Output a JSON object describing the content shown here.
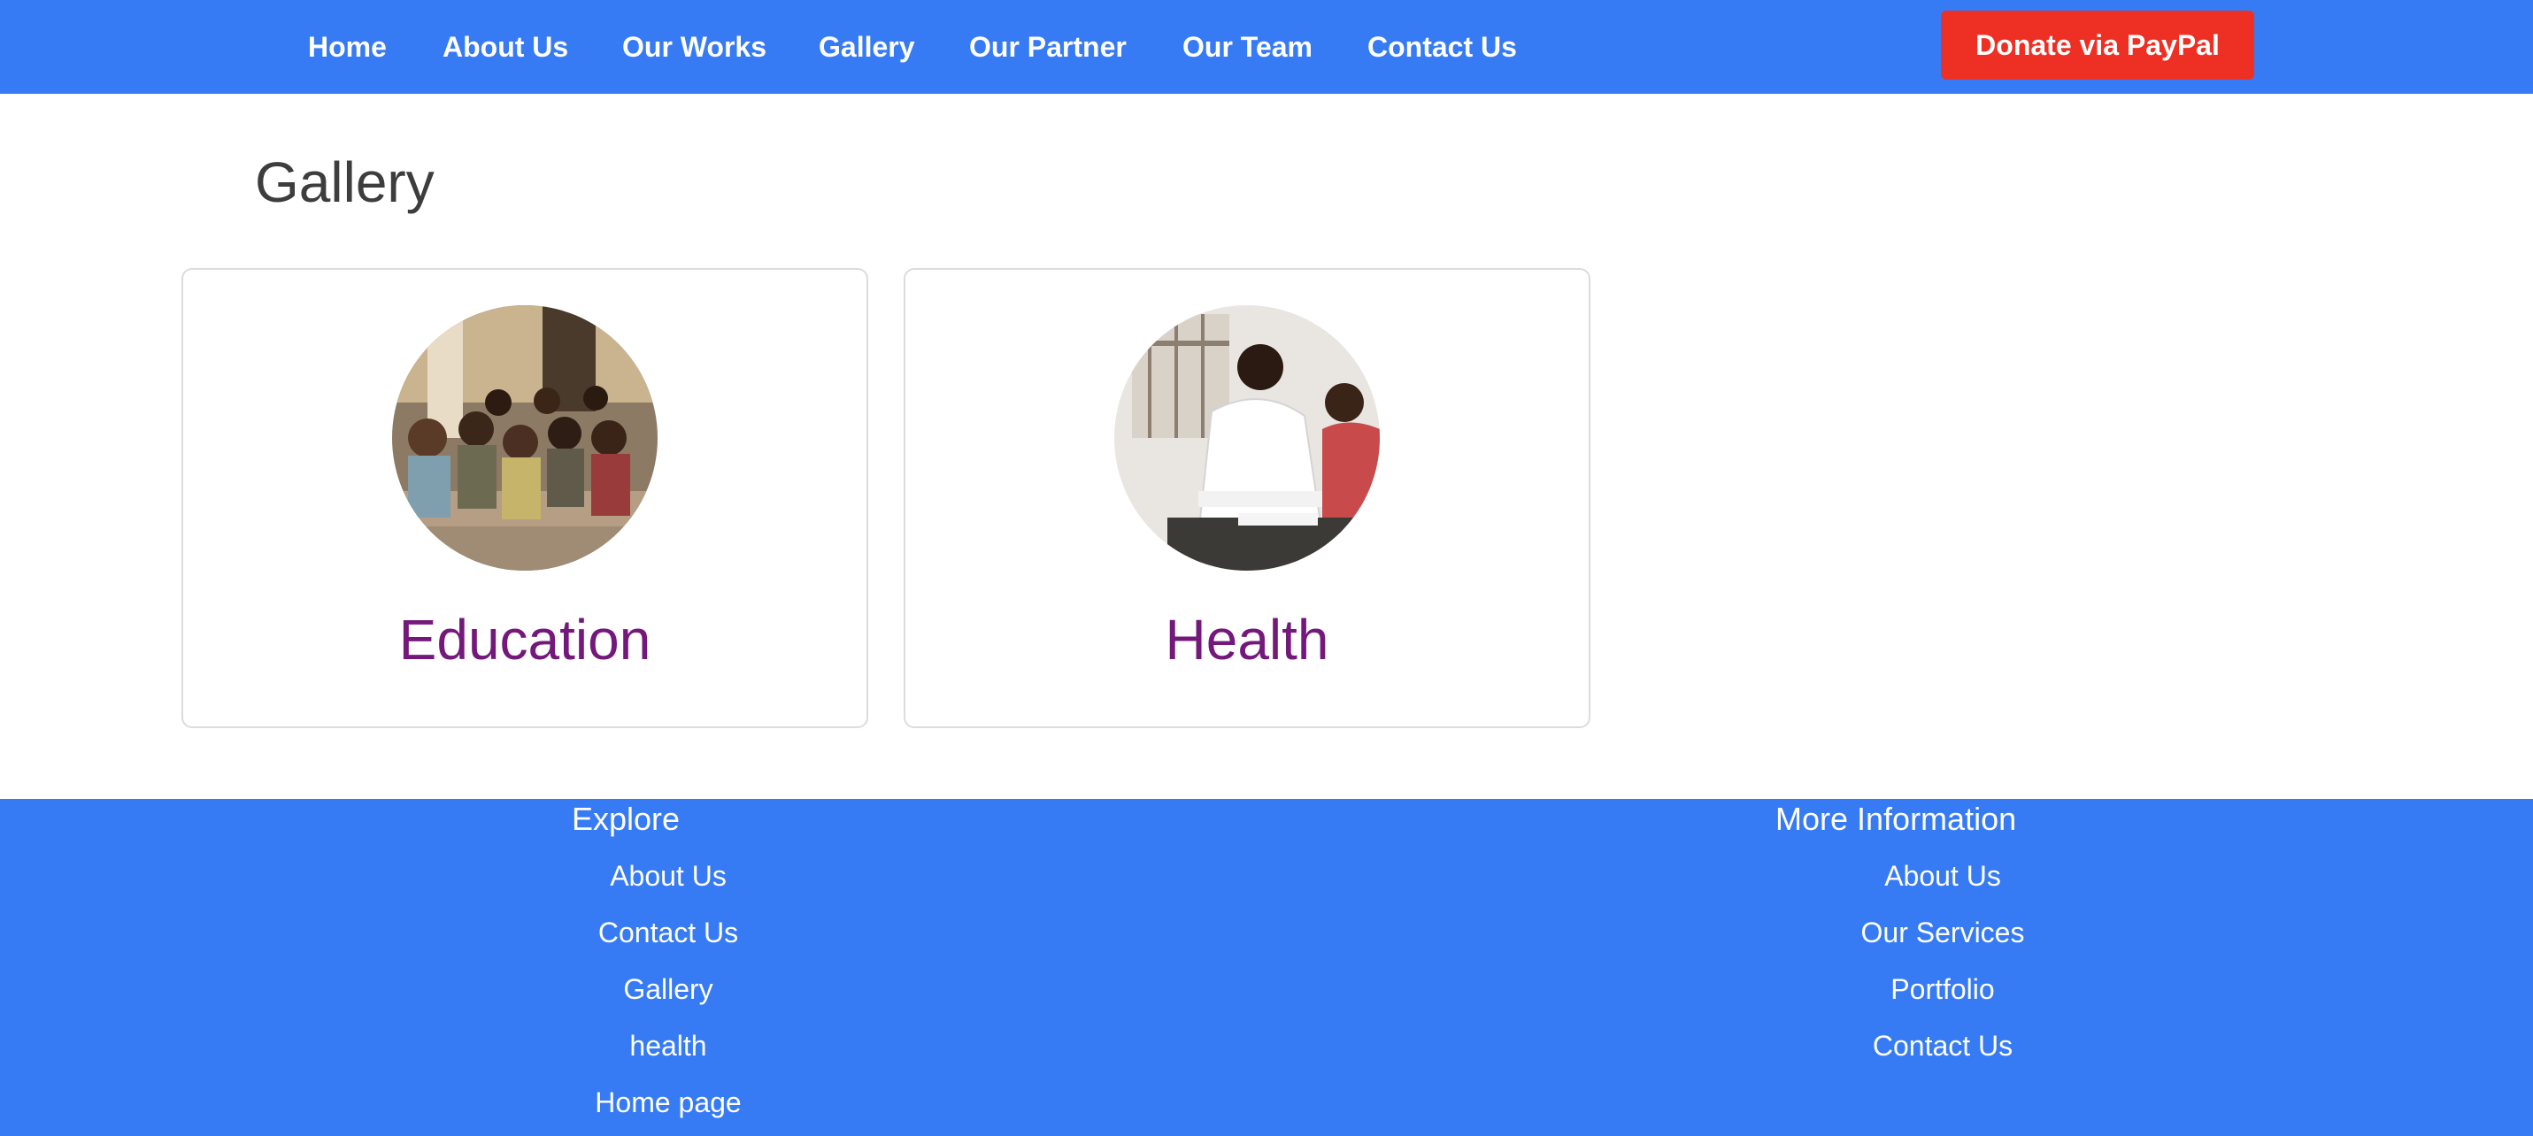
{
  "nav": {
    "links": [
      "Home",
      "About Us",
      "Our Works",
      "Gallery",
      "Our Partner",
      "Our Team",
      "Contact Us"
    ],
    "donate_label": "Donate via PayPal"
  },
  "page": {
    "title": "Gallery"
  },
  "gallery": {
    "cards": [
      {
        "title": "Education",
        "image_desc": "children-classroom-photo"
      },
      {
        "title": "Health",
        "image_desc": "doctor-patient-photo"
      }
    ]
  },
  "footer": {
    "explore": {
      "heading": "Explore",
      "links": [
        "About Us",
        "Contact Us",
        "Gallery",
        "health",
        "Home page"
      ]
    },
    "more_info": {
      "heading": "More Information",
      "links": [
        "About Us",
        "Our Services",
        "Portfolio",
        "Contact Us"
      ]
    }
  },
  "colors": {
    "primary_blue": "#377bf4",
    "donate_red": "#ee3024",
    "card_title_purple": "#74197b",
    "title_gray": "#3d3d3d"
  }
}
